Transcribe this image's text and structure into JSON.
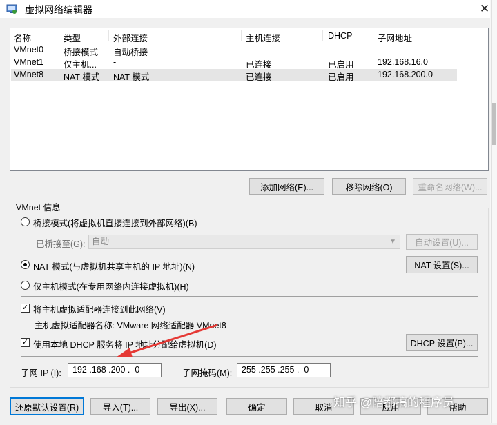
{
  "window": {
    "title": "虚拟网络编辑器",
    "close_glyph": "✕"
  },
  "network_list": {
    "columns": [
      "名称",
      "类型",
      "外部连接",
      "主机连接",
      "DHCP",
      "子网地址"
    ],
    "rows": [
      [
        "VMnet0",
        "桥接模式",
        "自动桥接",
        "-",
        "-",
        "-"
      ],
      [
        "VMnet1",
        "仅主机...",
        "-",
        "已连接",
        "已启用",
        "192.168.16.0"
      ],
      [
        "VMnet8",
        "NAT 模式",
        "NAT 模式",
        "已连接",
        "已启用",
        "192.168.200.0"
      ]
    ],
    "selected_row": 2
  },
  "list_buttons": {
    "add": "添加网络(E)...",
    "remove": "移除网络(O)",
    "rename": "重命名网络(W)..."
  },
  "vmnet_info": {
    "group_label": "VMnet 信息",
    "bridge_radio": "桥接模式(将虚拟机直接连接到外部网络)(B)",
    "bridged_to_label": "已桥接至(G):",
    "bridged_to_value": "自动",
    "auto_settings": "自动设置(U)...",
    "nat_radio": "NAT 模式(与虚拟机共享主机的 IP 地址)(N)",
    "nat_settings": "NAT 设置(S)...",
    "hostonly_radio": "仅主机模式(在专用网络内连接虚拟机)(H)",
    "connect_adapter_check": "将主机虚拟适配器连接到此网络(V)",
    "adapter_name_text": "主机虚拟适配器名称: VMware 网络适配器 VMnet8",
    "dhcp_check": "使用本地 DHCP 服务将 IP 地址分配给虚拟机(D)",
    "dhcp_settings": "DHCP 设置(P)...",
    "selected_mode": "nat",
    "connect_adapter_checked": true,
    "dhcp_checked": true
  },
  "subnet": {
    "ip_label": "子网 IP (I):",
    "ip_value": "192 .168 .200 .  0",
    "mask_label": "子网掩码(M):",
    "mask_value": "255 .255 .255 .  0"
  },
  "bottom_buttons": {
    "restore": "还原默认设置(R)",
    "import": "导入(T)...",
    "export": "导出(X)...",
    "ok": "确定",
    "cancel": "取消",
    "apply": "应用",
    "help": "帮助"
  },
  "annotation": {
    "arrow_color": "#e53935"
  },
  "watermark": "知乎 @陪都搞的程序员"
}
